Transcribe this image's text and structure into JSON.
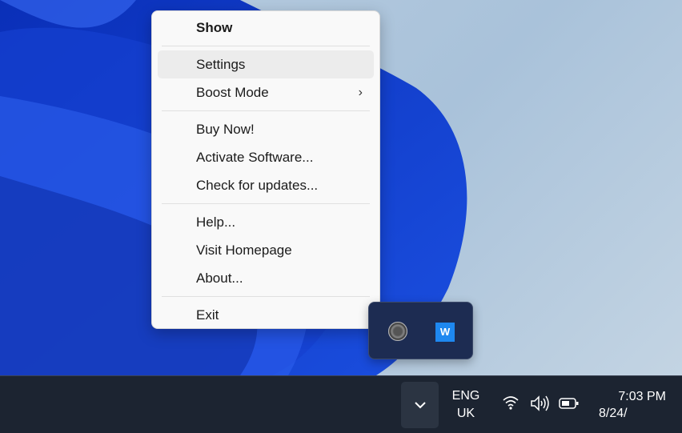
{
  "context_menu": {
    "items": [
      {
        "label": "Show",
        "bold": true
      },
      {
        "label": "Settings",
        "hover": true
      },
      {
        "label": "Boost Mode",
        "submenu": true
      },
      {
        "label": "Buy Now!"
      },
      {
        "label": "Activate Software..."
      },
      {
        "label": "Check for updates..."
      },
      {
        "label": "Help..."
      },
      {
        "label": "Visit Homepage"
      },
      {
        "label": "About..."
      },
      {
        "label": "Exit"
      }
    ],
    "submenu_chevron": "›"
  },
  "tray_flyout": {
    "icons": [
      "speaker-app-icon",
      "waves-app-icon"
    ],
    "waves_glyph": "W"
  },
  "taskbar": {
    "language": {
      "line1": "ENG",
      "line2": "UK"
    },
    "time": "7:03 PM",
    "date": "8/24/"
  },
  "colors": {
    "taskbar": "#1c2431",
    "menu": "#f9f9f9",
    "flyout": "#1d2c52",
    "accent": "#1e88f0"
  }
}
